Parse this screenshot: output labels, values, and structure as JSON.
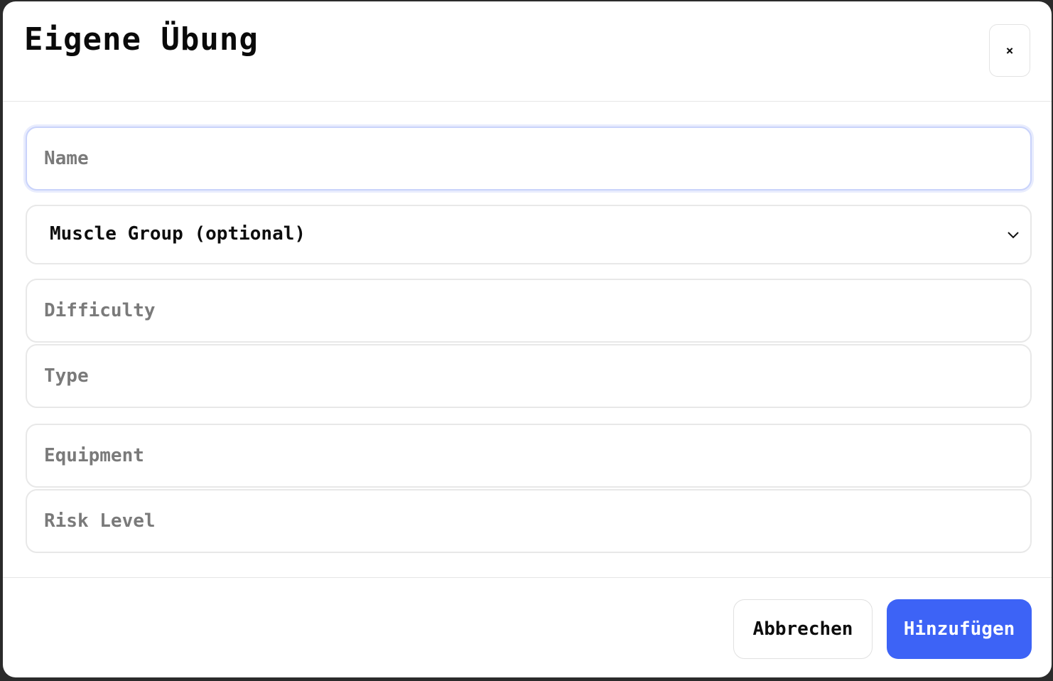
{
  "dialog": {
    "title": "Eigene Übung",
    "close_label": "×"
  },
  "form": {
    "name": {
      "placeholder": "Name",
      "value": ""
    },
    "muscle_group": {
      "selected": "Muscle Group (optional)"
    },
    "difficulty": {
      "placeholder": "Difficulty",
      "value": ""
    },
    "type": {
      "placeholder": "Type",
      "value": ""
    },
    "equipment": {
      "placeholder": "Equipment",
      "value": ""
    },
    "risk_level": {
      "placeholder": "Risk Level",
      "value": ""
    }
  },
  "footer": {
    "cancel_label": "Abbrechen",
    "add_label": "Hinzufügen"
  },
  "colors": {
    "primary": "#3d63f6",
    "focus_ring": "#c9d3fb",
    "border": "#e8e8e8",
    "placeholder": "#7a7a7a"
  },
  "icons": {
    "close": "close-icon",
    "select_arrow": "chevron-down-icon"
  }
}
